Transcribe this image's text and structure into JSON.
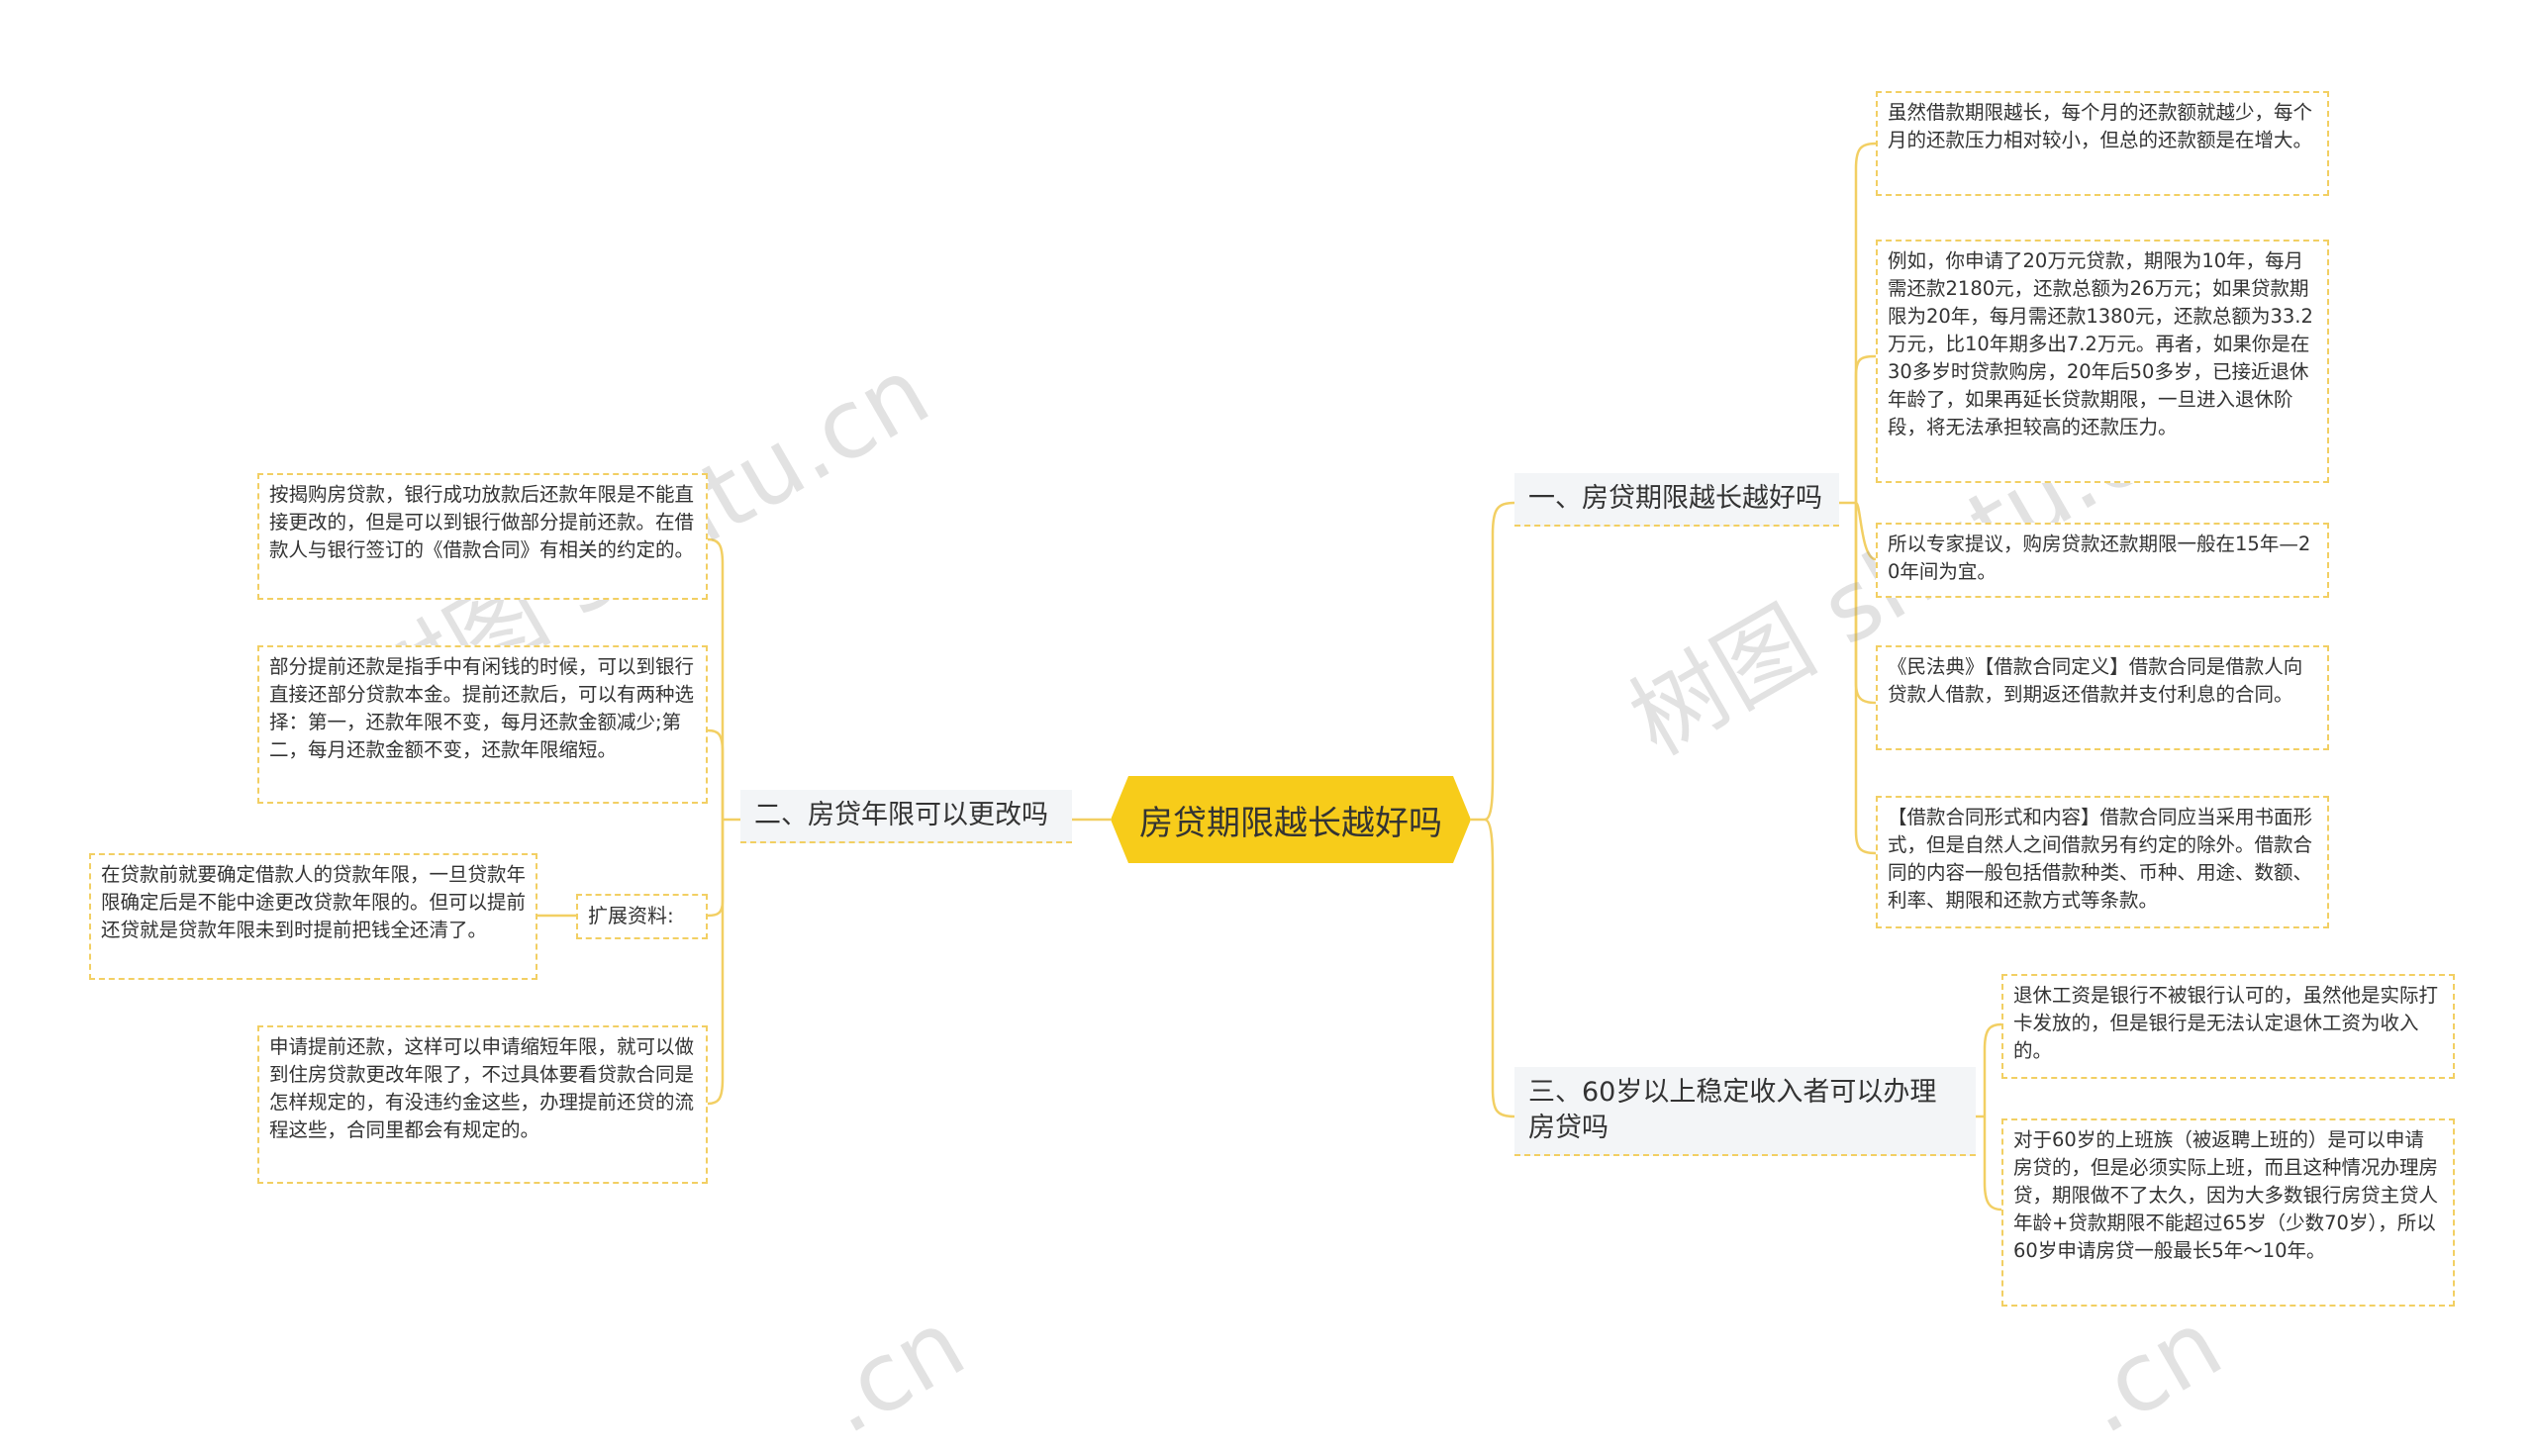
{
  "center": "房贷期限越长越好吗",
  "branches": {
    "b1": {
      "title": "一、房贷期限越长越好吗",
      "leaves": [
        "虽然借款期限越长，每个月的还款额就越少，每个月的还款压力相对较小，但总的还款额是在增大。",
        "例如，你申请了20万元贷款，期限为10年，每月需还款2180元，还款总额为26万元；如果贷款期限为20年，每月需还款1380元，还款总额为33.2万元，比10年期多出7.2万元。再者，如果你是在30多岁时贷款购房，20年后50多岁，已接近退休年龄了，如果再延长贷款期限，一旦进入退休阶段，将无法承担较高的还款压力。",
        "所以专家提议，购房贷款还款期限一般在15年—20年间为宜。",
        "《民法典》【借款合同定义】借款合同是借款人向贷款人借款，到期返还借款并支付利息的合同。",
        "【借款合同形式和内容】借款合同应当采用书面形式，但是自然人之间借款另有约定的除外。借款合同的内容一般包括借款种类、币种、用途、数额、利率、期限和还款方式等条款。"
      ]
    },
    "b2": {
      "title": "二、房贷年限可以更改吗",
      "leaves": [
        "按揭购房贷款，银行成功放款后还款年限是不能直接更改的，但是可以到银行做部分提前还款。在借款人与银行签订的《借款合同》有相关的约定的。",
        "部分提前还款是指手中有闲钱的时候，可以到银行直接还部分贷款本金。提前还款后，可以有两种选择：第一，还款年限不变，每月还款金额减少;第二，每月还款金额不变，还款年限缩短。",
        "申请提前还款，这样可以申请缩短年限，就可以做到住房贷款更改年限了，不过具体要看贷款合同是怎样规定的，有没违约金这些，办理提前还贷的流程这些，合同里都会有规定的。"
      ],
      "extension_label": "扩展资料:",
      "extension_text": "在贷款前就要确定借款人的贷款年限，一旦贷款年限确定后是不能中途更改贷款年限的。但可以提前还贷就是贷款年限未到时提前把钱全还清了。"
    },
    "b3": {
      "title": "三、60岁以上稳定收入者可以办理房贷吗",
      "leaves": [
        "退休工资是银行不被银行认可的，虽然他是实际打卡发放的，但是银行是无法认定退休工资为收入的。",
        "对于60岁的上班族（被返聘上班的）是可以申请房贷的，但是必须实际上班，而且这种情况办理房贷，期限做不了太久，因为大多数银行房贷主贷人年龄+贷款期限不能超过65岁（少数70岁），所以60岁申请房贷一般最长5年～10年。"
      ]
    }
  },
  "colors": {
    "center_fill": "#f7cc1a",
    "line": "#f2cf63",
    "branch_fill": "#f3f5f7"
  },
  "watermarks": [
    "树图 shutu.cn",
    "树图 shutu.cn",
    ".cn",
    ".cn"
  ]
}
